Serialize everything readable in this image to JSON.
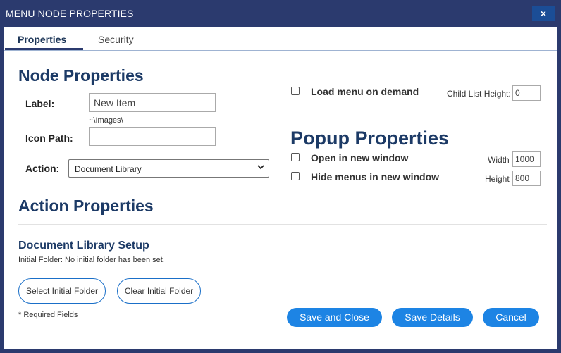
{
  "window": {
    "title": "MENU NODE PROPERTIES",
    "close_label": "×"
  },
  "tabs": [
    {
      "label": "Properties",
      "active": true
    },
    {
      "label": "Security",
      "active": false
    }
  ],
  "node_properties": {
    "heading": "Node Properties",
    "label_label": "Label:",
    "label_value": "New Item",
    "icon_path_hint": "~\\Images\\",
    "icon_path_label": "Icon Path:",
    "icon_path_value": "",
    "action_label": "Action:",
    "action_value": "Document Library"
  },
  "load_on_demand": {
    "label": "Load menu on demand",
    "checked": false
  },
  "child_list_height": {
    "label": "Child List Height:",
    "value": "0"
  },
  "popup_properties": {
    "heading": "Popup Properties",
    "open_new_window": {
      "label": "Open in new window",
      "checked": false
    },
    "hide_menus": {
      "label": "Hide menus in new window",
      "checked": false
    },
    "width_label": "Width",
    "width_value": "1000",
    "height_label": "Height",
    "height_value": "800"
  },
  "action_properties": {
    "heading": "Action Properties"
  },
  "document_library": {
    "heading": "Document Library Setup",
    "initial_folder_text": "Initial Folder: No initial folder has been set.",
    "select_button": "Select Initial Folder",
    "clear_button": "Clear Initial Folder"
  },
  "footer": {
    "required_note": "* Required Fields",
    "save_close": "Save and Close",
    "save_details": "Save Details",
    "cancel": "Cancel"
  },
  "colors": {
    "titlebar": "#2b3a6e",
    "heading": "#1c3a66",
    "primary_button": "#1d84e4",
    "outline_button_border": "#1a6fc8"
  }
}
